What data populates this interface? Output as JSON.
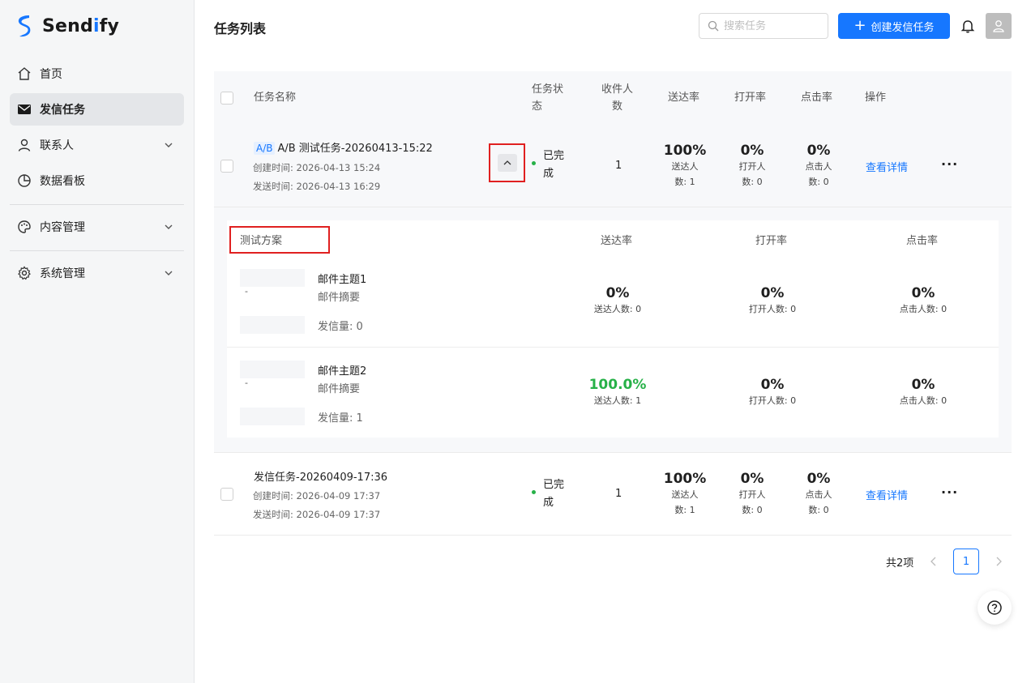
{
  "app": {
    "brand_prefix": "Send",
    "brand_accent": "i",
    "brand_suffix": "fy",
    "accent_color": "#1677ff"
  },
  "sidebar": {
    "items": [
      {
        "label": "首页",
        "icon": "home-icon"
      },
      {
        "label": "发信任务",
        "icon": "mail-icon",
        "active": true
      },
      {
        "label": "联系人",
        "icon": "user-icon",
        "expandable": true
      },
      {
        "label": "数据看板",
        "icon": "pie-chart-icon"
      },
      {
        "label": "内容管理",
        "icon": "palette-icon",
        "expandable": true
      },
      {
        "label": "系统管理",
        "icon": "gear-icon",
        "expandable": true
      }
    ]
  },
  "header": {
    "title": "任务列表",
    "search_placeholder": "搜索任务",
    "create_label": "创建发信任务"
  },
  "table": {
    "columns": {
      "name": "任务名称",
      "status_l1": "任务状",
      "status_l2": "态",
      "recipients_l1": "收件人",
      "recipients_l2": "数",
      "delivery": "送达率",
      "open": "打开率",
      "click": "点击率",
      "actions": "操作"
    },
    "rows": [
      {
        "tag": "A/B",
        "name": "A/B 测试任务-20260413-15:22",
        "created": "创建时间: 2026-04-13 15:24",
        "sent": "发送时间: 2026-04-13 16:29",
        "status_l1": "已完",
        "status_l2": "成",
        "recipients": "1",
        "delivery_rate": "100%",
        "delivery_sub_l1": "送达人",
        "delivery_sub_l2": "数: 1",
        "open_rate": "0%",
        "open_sub_l1": "打开人",
        "open_sub_l2": "数: 0",
        "click_rate": "0%",
        "click_sub_l1": "点击人",
        "click_sub_l2": "数: 0",
        "detail_label": "查看详情",
        "more_label": "···"
      },
      {
        "name": "发信任务-20260409-17:36",
        "created": "创建时间: 2026-04-09 17:37",
        "sent": "发送时间: 2026-04-09 17:37",
        "status_l1": "已完",
        "status_l2": "成",
        "recipients": "1",
        "delivery_rate": "100%",
        "delivery_sub_l1": "送达人",
        "delivery_sub_l2": "数: 1",
        "open_rate": "0%",
        "open_sub_l1": "打开人",
        "open_sub_l2": "数: 0",
        "click_rate": "0%",
        "click_sub_l1": "点击人",
        "click_sub_l2": "数: 0",
        "detail_label": "查看详情",
        "more_label": "···"
      }
    ]
  },
  "ab_test": {
    "columns": {
      "plan": "测试方案",
      "delivery": "送达率",
      "open": "打开率",
      "click": "点击率"
    },
    "plans": [
      {
        "thumb_dash": "-",
        "subject": "邮件主题1",
        "summary": "邮件摘要",
        "volume": "发信量: 0",
        "delivery_rate": "0%",
        "delivery_count": "送达人数: 0",
        "open_rate": "0%",
        "open_count": "打开人数: 0",
        "click_rate": "0%",
        "click_count": "点击人数: 0"
      },
      {
        "thumb_dash": "-",
        "subject": "邮件主题2",
        "summary": "邮件摘要",
        "volume": "发信量: 1",
        "delivery_rate": "100.0%",
        "delivery_count": "送达人数: 1",
        "open_rate": "0%",
        "open_count": "打开人数: 0",
        "click_rate": "0%",
        "click_count": "点击人数: 0"
      }
    ]
  },
  "pagination": {
    "total": "共2项",
    "current_page": "1"
  }
}
